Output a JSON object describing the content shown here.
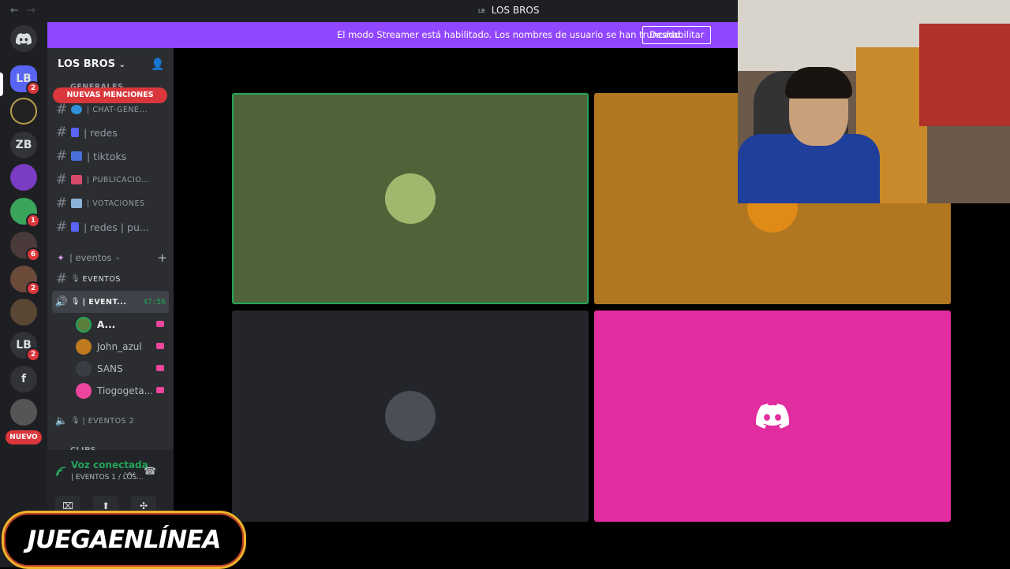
{
  "window": {
    "back": "←",
    "forward": "→",
    "server_tag": "LB",
    "title": "LOS BROS"
  },
  "banner": {
    "text": "El modo Streamer está habilitado. Los nombres de usuario se han truncado.",
    "button": "Deshabilitar"
  },
  "rail": {
    "items": [
      {
        "label": "LB",
        "badge": "2"
      },
      {
        "label": "ZB"
      },
      {
        "label": "LB",
        "badge": "2"
      },
      {
        "label": "f"
      }
    ],
    "badges": [
      "1",
      "6",
      "2"
    ],
    "new_label": "NUEVO"
  },
  "sidebar": {
    "guild_name": "LOS BROS",
    "mentions": "NUEVAS MENCIONES",
    "category_generales": "GENERALES",
    "channels": [
      {
        "name": "| CHAT-GENE...",
        "type": "text"
      },
      {
        "name": "| redes",
        "type": "text"
      },
      {
        "name": "| tiktoks",
        "type": "text"
      },
      {
        "name": "| PUBLICACIO...",
        "type": "text"
      },
      {
        "name": "| VOTACIONES",
        "type": "text"
      },
      {
        "name": "| redes | pu...",
        "type": "text"
      }
    ],
    "category_eventos": "| eventos",
    "eventos_text": "EVENTOS",
    "voice_channel": {
      "name": "| EVENT...",
      "timer": "47:56"
    },
    "members": [
      {
        "name": "A...",
        "color": "#5a7d3c"
      },
      {
        "name": "John_azul",
        "color": "#c07a1e"
      },
      {
        "name": "SANS",
        "color": "#3a3d44"
      },
      {
        "name": "Tiogogeta...",
        "color": "#eb459e"
      }
    ],
    "voice_channel_2": "| EVENTOS 2",
    "category_clips": "CLIPS"
  },
  "voice_panel": {
    "status": "Voz conectada",
    "location": "| EVENTOS 1 / LOS..."
  },
  "tiles": [
    {
      "user": "A...",
      "bg": "#4e6438",
      "speaking": true
    },
    {
      "user": "John_azul",
      "bg": "#b07620",
      "speaking": false
    },
    {
      "user": "SANS",
      "bg": "#23252b",
      "speaking": false
    },
    {
      "user": "Tiogogeta...",
      "bg": "#e12d9f",
      "speaking": false
    }
  ],
  "watermark": {
    "text": "JUEGAENLÍNEA"
  },
  "colors": {
    "accent": "#9146ff",
    "danger": "#da373c",
    "speaking": "#23a559",
    "pink": "#eb459e"
  }
}
